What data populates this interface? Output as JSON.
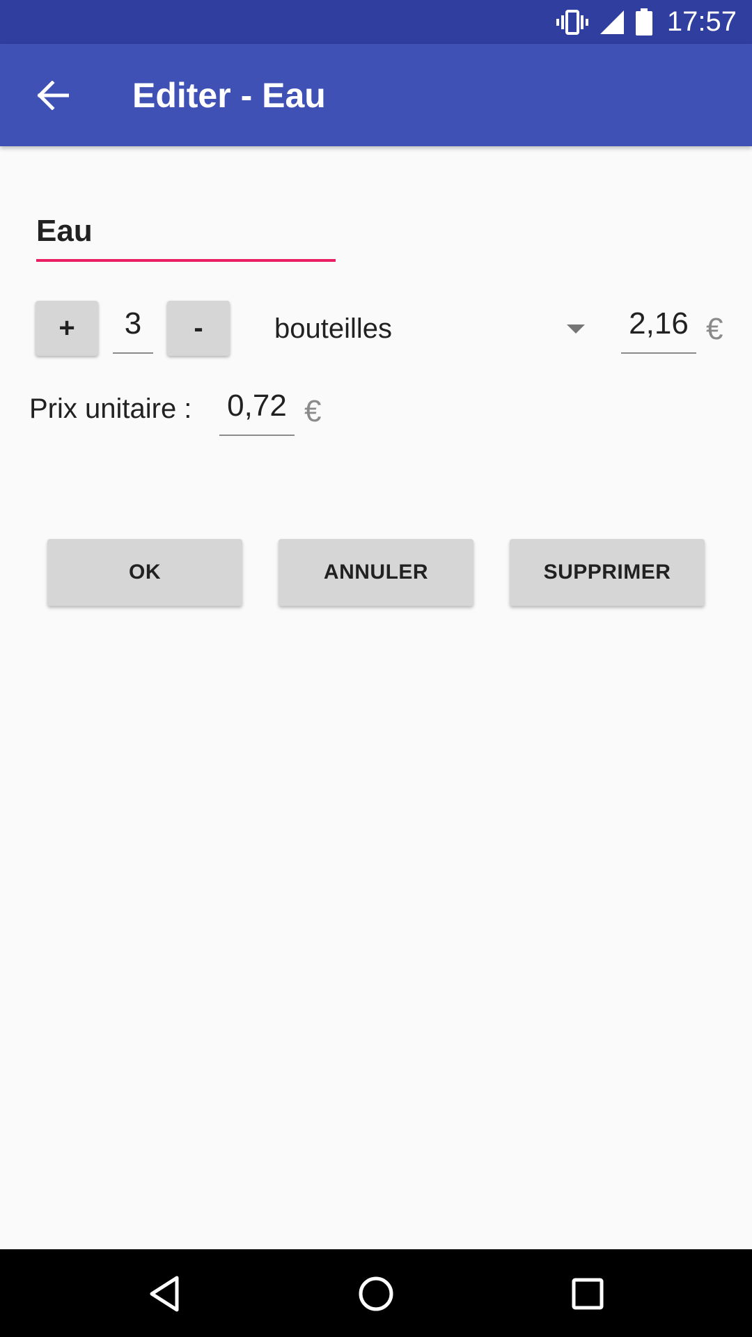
{
  "status_bar": {
    "time": "17:57",
    "icons": [
      "vibrate-icon",
      "signal-icon",
      "battery-icon"
    ],
    "color": "#303f9f"
  },
  "app_bar": {
    "title": "Editer - Eau",
    "back_icon": "arrow-back-icon",
    "color": "#3f51b5"
  },
  "form": {
    "name_value": "Eau",
    "name_underline_color": "#e91e63",
    "increment_label": "+",
    "quantity_value": "3",
    "decrement_label": "-",
    "unit_selected": "bouteilles",
    "total_value": "2,16",
    "currency": "€",
    "unit_price_label": "Prix unitaire :",
    "unit_price_value": "0,72"
  },
  "actions": {
    "ok_label": "OK",
    "cancel_label": "ANNULER",
    "delete_label": "SUPPRIMER"
  },
  "nav_bar": {
    "icons": [
      "back-triangle-icon",
      "home-circle-icon",
      "recents-square-icon"
    ]
  }
}
